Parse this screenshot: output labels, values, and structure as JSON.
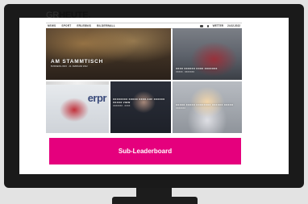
{
  "site": {
    "logo_light": "GR",
    "logo_bold": "HEUTE."
  },
  "nav": {
    "items": [
      "NEWS",
      "SPORT",
      "ERLEBNIS",
      "BILDERWALL"
    ],
    "weather": "WETTER",
    "date": "24.02.2022"
  },
  "tiles": {
    "main": {
      "headline": "AM STAMMTISCH",
      "sub": "BUSINESS-INFO · 24. FEBRUAR 2022"
    },
    "top_right": {
      "headline": "XXXX XXXXXX XXXX XXXXXXX",
      "sub": "XXXXX · XXXXXXX"
    },
    "hockey": {
      "sponsor": "erpr"
    },
    "man": {
      "headline": "XXXXXXXX XXXXX XXXX AUF XXXXXX XXXXX VIEW",
      "sub": "XXXXXXX · XXXX"
    },
    "woman": {
      "headline": "XXXXX XXXXX XXXXXXXX XXXXXX XXXXX",
      "sub": "XXXXXXX"
    }
  },
  "ad": {
    "label": "Sub-Leaderboard",
    "color": "#e5007d"
  }
}
